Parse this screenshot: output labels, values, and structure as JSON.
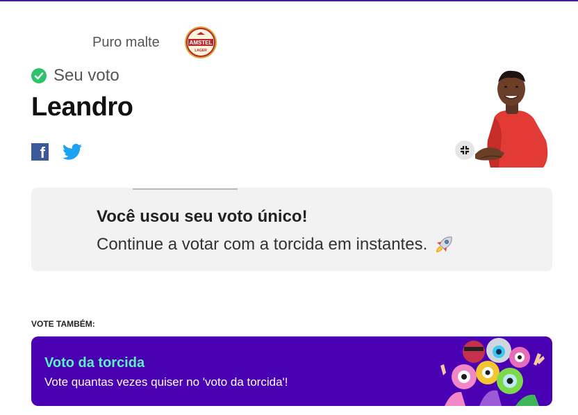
{
  "sponsor": {
    "label": "Puro malte",
    "logo_text": "AMSTEL",
    "logo_sub": "LAGER"
  },
  "vote": {
    "status": "Seu voto",
    "candidate": "Leandro"
  },
  "share": {
    "facebook_glyph": "f"
  },
  "notice": {
    "title": "Você usou seu voto único!",
    "text": "Continue a votar com a torcida em instantes."
  },
  "also": {
    "label": "VOTE TAMBÉM:"
  },
  "torcida": {
    "title": "Voto da torcida",
    "subtitle": "Vote quantas vezes quiser no 'voto da torcida'!"
  },
  "icons": {
    "status": "check-circle-icon",
    "facebook": "facebook-icon",
    "twitter": "twitter-icon",
    "expand": "expand-icon",
    "rocket": "rocket-icon"
  },
  "colors": {
    "accent_purple": "#4a00b3",
    "accent_green": "#5ff0c2",
    "check_green": "#2ec36b",
    "facebook_blue": "#3b5998",
    "twitter_blue": "#1da1f2"
  }
}
